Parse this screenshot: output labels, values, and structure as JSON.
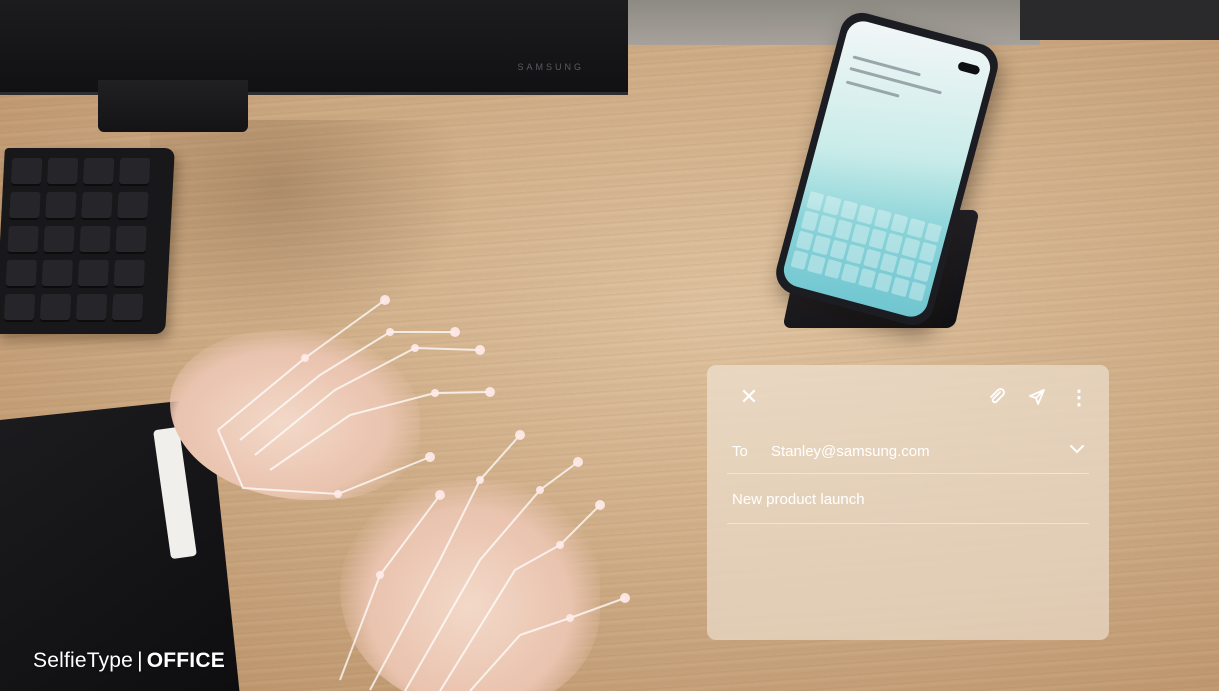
{
  "monitor": {
    "brand": "SAMSUNG"
  },
  "email_panel": {
    "close_icon": "close-icon",
    "attach_icon": "paperclip-icon",
    "send_icon": "send-icon",
    "more_icon": "more-vertical-icon",
    "to_label": "To",
    "to_value": "Stanley@samsung.com",
    "expand_icon": "chevron-down-icon",
    "subject": "New product launch"
  },
  "caption": {
    "product": "SelfieType",
    "separator": "|",
    "mode": "OFFICE"
  },
  "colors": {
    "panel_text": "#ffffff",
    "desk": "#cfae88",
    "skeleton_line": "#ffffff"
  }
}
